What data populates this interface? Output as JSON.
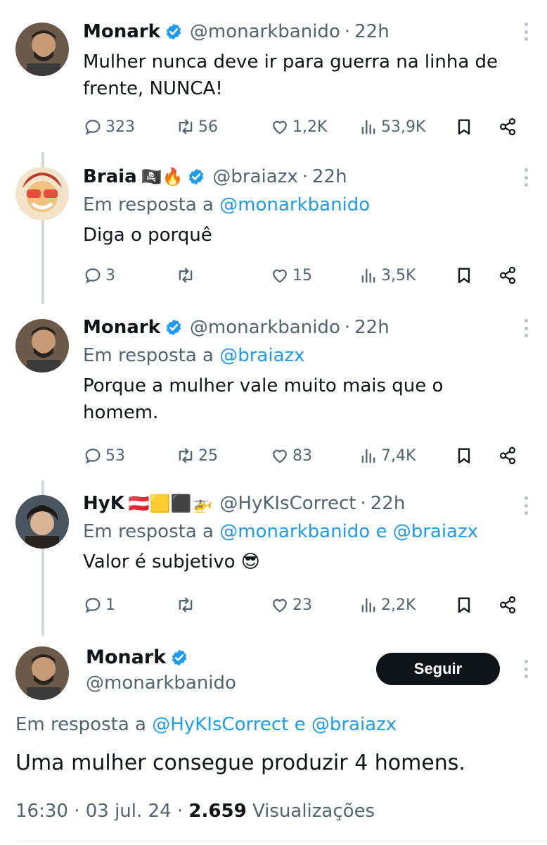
{
  "colors": {
    "text": "#0f1419",
    "secondary": "#536471",
    "link": "#1d9bf0",
    "verified": "#1d9bf0",
    "thread_line": "#cfd9de"
  },
  "reply_prefix": "Em resposta a",
  "tweets": [
    {
      "name": "Monark",
      "flags": "",
      "handle": "@monarkbanido",
      "time": "22h",
      "reply_to": "",
      "text": "Mulher nunca deve ir para guerra na linha de frente, NUNCA!",
      "replies": "323",
      "retweets": "56",
      "likes": "1,2K",
      "views": "53,9K"
    },
    {
      "name": "Braia",
      "flags": "🏴‍☠️🔥",
      "handle": "@braiazx",
      "time": "22h",
      "reply_to": "@monarkbanido",
      "text": "Diga o porquê",
      "replies": "3",
      "retweets": "",
      "likes": "15",
      "views": "3,5K"
    },
    {
      "name": "Monark",
      "flags": "",
      "handle": "@monarkbanido",
      "time": "22h",
      "reply_to": "@braiazx",
      "text": "Porque a mulher vale muito mais que o homem.",
      "replies": "53",
      "retweets": "25",
      "likes": "83",
      "views": "7,4K"
    },
    {
      "name": "HyK",
      "flags": "🇦🇹🟨⬛🚁",
      "handle": "@HyKIsCorrect",
      "time": "22h",
      "reply_to": "@monarkbanido e @braiazx",
      "text": "Valor é subjetivo 😎",
      "replies": "1",
      "retweets": "",
      "likes": "23",
      "views": "2,2K"
    }
  ],
  "main_tweet": {
    "name": "Monark",
    "handle": "@monarkbanido",
    "follow_label": "Seguir",
    "reply_to": "@HyKIsCorrect e @braiazx",
    "text": "Uma mulher consegue produzir 4 homens.",
    "time": "16:30",
    "date": "03 jul. 24",
    "views_count": "2.659",
    "views_label": "Visualizações"
  },
  "icons": [
    "reply-icon",
    "retweet-icon",
    "like-icon",
    "views-icon",
    "bookmark-icon",
    "share-icon",
    "verified-badge-icon",
    "more-icon"
  ]
}
